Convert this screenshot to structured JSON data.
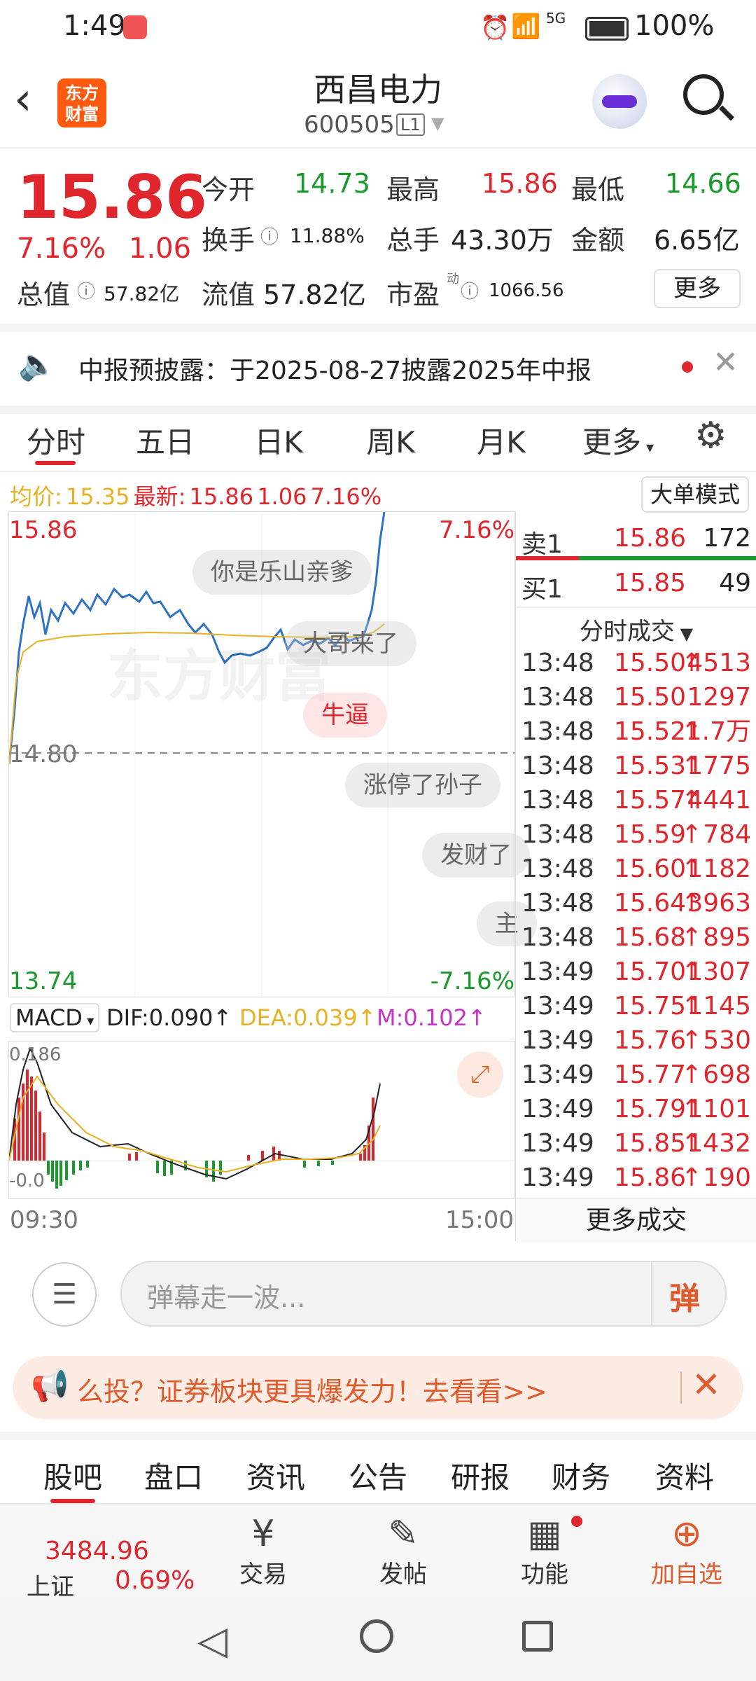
{
  "status_bar": {
    "time": "1:49",
    "battery": "100%",
    "network": "5G"
  },
  "header": {
    "logo_text": "东方财富",
    "title": "西昌电力",
    "code": "600505",
    "level": "L1"
  },
  "quote": {
    "price": "15.86",
    "pct": "7.16%",
    "change": "1.06",
    "open_label": "今开",
    "open": "14.73",
    "high_label": "最高",
    "high": "15.86",
    "low_label": "最低",
    "low": "14.66",
    "turnover_label": "换手",
    "turnover": "11.88%",
    "volume_label": "总手",
    "volume": "43.30万",
    "amount_label": "金额",
    "amount": "6.65亿",
    "mcap_label": "总值",
    "mcap": "57.82亿",
    "float_label": "流值",
    "float": "57.82亿",
    "pe_label": "市盈",
    "pe_sup": "动",
    "pe": "1066.56",
    "more": "更多"
  },
  "notice": {
    "text": "中报预披露：于2025-08-27披露2025年中报"
  },
  "tabs": [
    "分时",
    "五日",
    "日K",
    "周K",
    "月K",
    "更多"
  ],
  "avg_line": {
    "avg_label": "均价:",
    "avg": "15.35",
    "latest_label": "最新:",
    "latest": "15.86",
    "chg": "1.06",
    "pct": "7.16%",
    "mode_btn": "大单模式"
  },
  "chart": {
    "top_price": "15.86",
    "top_pct": "7.16%",
    "mid_price": "14.80",
    "bottom_price": "13.74",
    "bottom_pct": "-7.16%",
    "start_time": "09:30",
    "end_time": "15:00",
    "watermark": "东方财富",
    "danmu": [
      "你是乐山亲爹",
      "大哥来了",
      "牛逼",
      "涨停了孙子",
      "发财了",
      "主"
    ]
  },
  "macd": {
    "label": "MACD",
    "dif": "DIF:0.090",
    "dea": "DEA:0.039",
    "m": "M:0.102",
    "top": "0.186",
    "bottom": "-0.0"
  },
  "orderbook": {
    "sell_label": "卖1",
    "sell_price": "15.86",
    "sell_vol": "172",
    "buy_label": "买1",
    "buy_price": "15.85",
    "buy_vol": "49",
    "trades_title": "分时成交",
    "trades": [
      {
        "t": "13:48",
        "p": "15.50",
        "a": "↑",
        "v": "4513"
      },
      {
        "t": "13:48",
        "p": "15.50",
        "a": "",
        "v": "1297"
      },
      {
        "t": "13:48",
        "p": "15.52",
        "a": "↑",
        "v": "1.7万"
      },
      {
        "t": "13:48",
        "p": "15.53",
        "a": "↑",
        "v": "1775"
      },
      {
        "t": "13:48",
        "p": "15.57",
        "a": "↑",
        "v": "4441"
      },
      {
        "t": "13:48",
        "p": "15.59",
        "a": "↑",
        "v": "784"
      },
      {
        "t": "13:48",
        "p": "15.60",
        "a": "↑",
        "v": "1182"
      },
      {
        "t": "13:48",
        "p": "15.64",
        "a": "↑",
        "v": "3963"
      },
      {
        "t": "13:48",
        "p": "15.68",
        "a": "↑",
        "v": "895"
      },
      {
        "t": "13:49",
        "p": "15.70",
        "a": "↑",
        "v": "1307"
      },
      {
        "t": "13:49",
        "p": "15.75",
        "a": "↑",
        "v": "1145"
      },
      {
        "t": "13:49",
        "p": "15.76",
        "a": "↑",
        "v": "530"
      },
      {
        "t": "13:49",
        "p": "15.77",
        "a": "↑",
        "v": "698"
      },
      {
        "t": "13:49",
        "p": "15.79",
        "a": "↑",
        "v": "1101"
      },
      {
        "t": "13:49",
        "p": "15.85",
        "a": "↑",
        "v": "1432"
      },
      {
        "t": "13:49",
        "p": "15.86",
        "a": "↑",
        "v": "190"
      }
    ],
    "more_trades": "更多成交"
  },
  "danmu_input": {
    "placeholder": "弹幕走一波...",
    "send": "弹"
  },
  "banner": {
    "text": "么投？证券板块更具爆发力！去看看>>"
  },
  "bottom_tabs": [
    "股吧",
    "盘口",
    "资讯",
    "公告",
    "研报",
    "财务",
    "资料"
  ],
  "bottom_nav": {
    "index_value": "3484.96",
    "index_name": "上证",
    "index_pct": "0.69%",
    "trade": "交易",
    "post": "发帖",
    "func": "功能",
    "add": "加自选"
  }
}
